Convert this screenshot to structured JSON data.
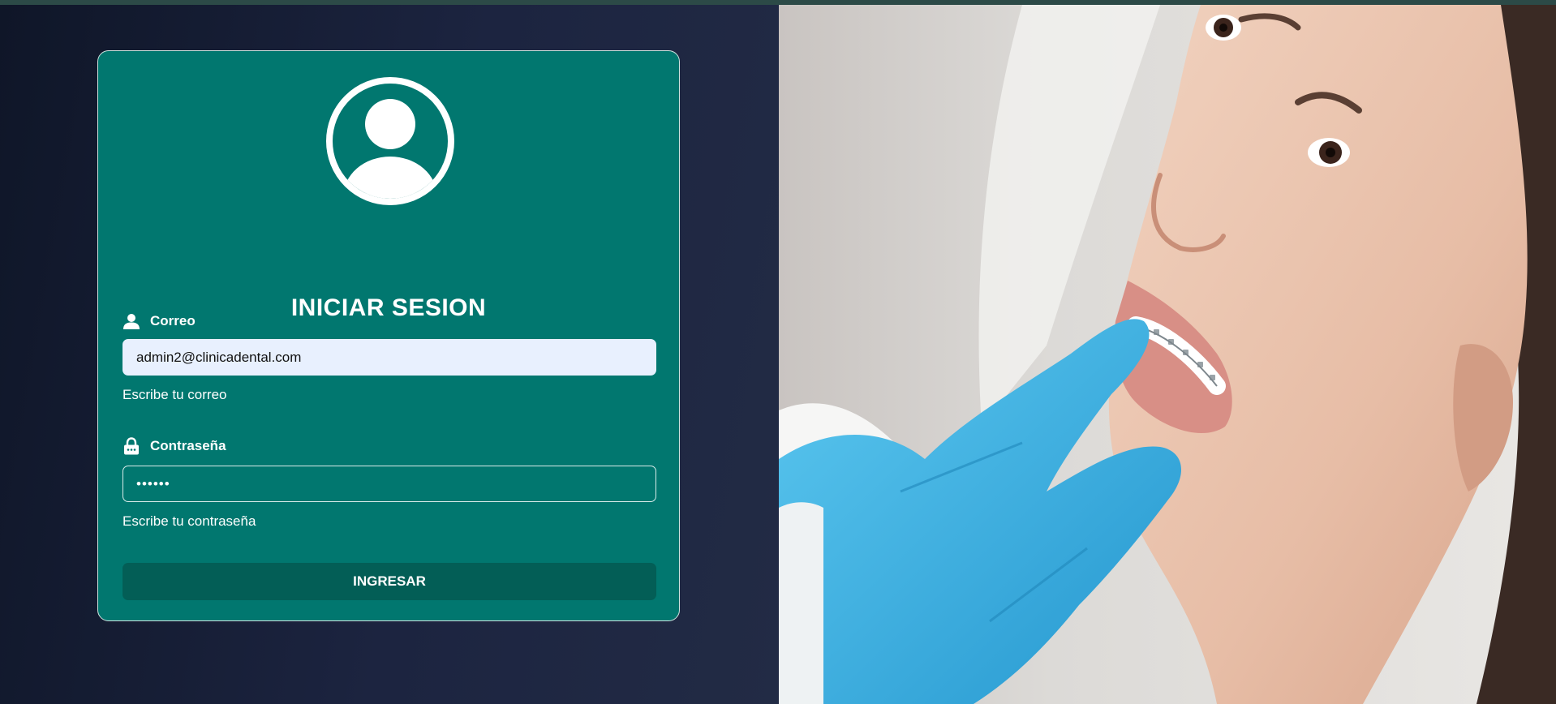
{
  "login": {
    "title": "INICIAR SESION",
    "avatar_icon": "user-circle-icon",
    "email": {
      "icon": "person-icon",
      "label": "Correo",
      "value": "admin2@clinicadental.com",
      "hint": "Escribe tu correo"
    },
    "password": {
      "icon": "lock-icon",
      "label": "Contraseña",
      "value": "••••••",
      "hint": "Escribe tu contraseña"
    },
    "submit_label": "INGRESAR"
  },
  "colors": {
    "card": "#01776f",
    "button": "#035e56",
    "background": "#1c2440",
    "glove": "#3bb6e6"
  }
}
